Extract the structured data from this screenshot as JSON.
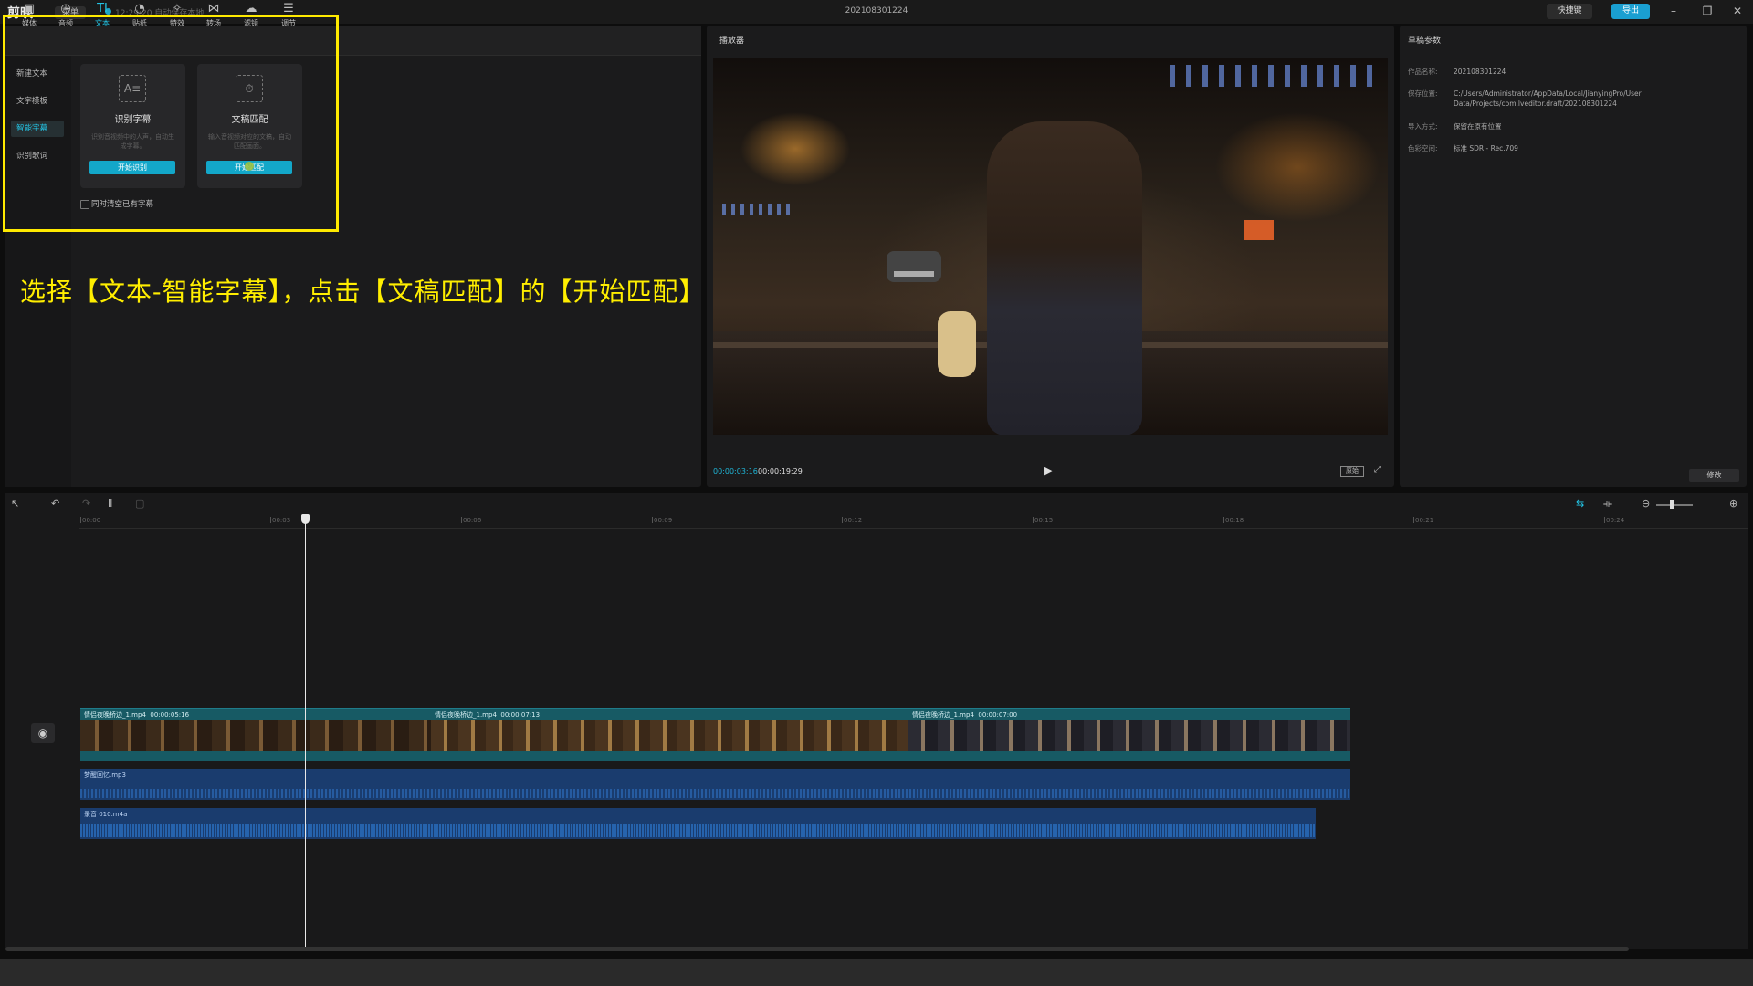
{
  "app": {
    "name": "剪映",
    "menu_label": "菜单",
    "save_status": "12:29:20 自动保存本地",
    "project_title": "202108301224",
    "shortcut_label": "快捷键",
    "export_label": "导出",
    "watermark": "虎课网"
  },
  "tool_tabs": [
    {
      "label": "媒体",
      "icon": "media-icon"
    },
    {
      "label": "音频",
      "icon": "audio-icon"
    },
    {
      "label": "文本",
      "icon": "text-icon",
      "active": true
    },
    {
      "label": "贴纸",
      "icon": "sticker-icon"
    },
    {
      "label": "特效",
      "icon": "effects-icon"
    },
    {
      "label": "转场",
      "icon": "transition-icon"
    },
    {
      "label": "滤镜",
      "icon": "filter-icon"
    },
    {
      "label": "调节",
      "icon": "adjust-icon"
    }
  ],
  "side_menu": [
    {
      "label": "新建文本"
    },
    {
      "label": "文字模板"
    },
    {
      "label": "智能字幕",
      "active": true
    },
    {
      "label": "识别歌词"
    }
  ],
  "cards": {
    "recognize": {
      "title": "识别字幕",
      "desc": "识别音视频中的人声，自动生成字幕。",
      "button": "开始识别"
    },
    "match": {
      "title": "文稿匹配",
      "desc": "输入音视频对应的文稿，自动匹配画面。",
      "button": "开始匹配"
    },
    "clear_label": "同时清空已有字幕"
  },
  "instruction": "选择【文本-智能字幕】，点击【文稿匹配】的【开始匹配】",
  "player": {
    "title": "播放器",
    "time_current": "00:00:03:16",
    "time_total": "00:00:19:29",
    "ratio_label": "原始"
  },
  "params": {
    "title": "草稿参数",
    "rows": [
      {
        "k": "作品名称:",
        "v": "202108301224"
      },
      {
        "k": "保存位置:",
        "v": "C:/Users/Administrator/AppData/Local/JianyingPro/User Data/Projects/com.lveditor.draft/202108301224"
      },
      {
        "k": "导入方式:",
        "v": "保留在原有位置"
      },
      {
        "k": "色彩空间:",
        "v": "标准 SDR - Rec.709"
      }
    ],
    "modify_label": "修改"
  },
  "timeline": {
    "ticks": [
      "00:00",
      "00:03",
      "00:06",
      "00:09",
      "00:12",
      "00:15",
      "00:18",
      "00:21",
      "00:24"
    ],
    "clips": [
      {
        "name": "情侣夜晚桥边_1.mp4",
        "duration": "00:00:05:16"
      },
      {
        "name": "情侣夜晚桥边_1.mp4",
        "duration": "00:00:07:13"
      },
      {
        "name": "情侣夜晚桥边_1.mp4",
        "duration": "00:00:07:00"
      }
    ],
    "audio_music": "梦醒回忆.mp3",
    "audio_voice": "录音 010.m4a"
  }
}
